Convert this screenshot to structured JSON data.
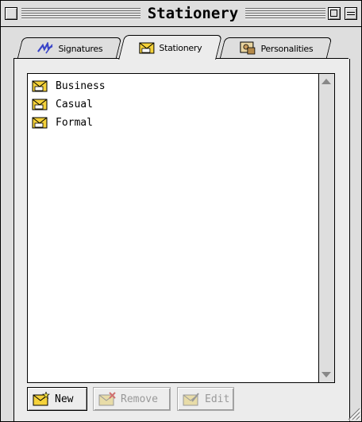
{
  "window": {
    "title": "Stationery"
  },
  "tabs": [
    {
      "label": "Signatures",
      "icon": "pen-icon",
      "active": false
    },
    {
      "label": "Stationery",
      "icon": "stationery-icon",
      "active": true
    },
    {
      "label": "Personalities",
      "icon": "personalities-icon",
      "active": false
    }
  ],
  "list": {
    "items": [
      {
        "label": "Business",
        "icon": "stationery-icon"
      },
      {
        "label": "Casual",
        "icon": "stationery-icon"
      },
      {
        "label": "Formal",
        "icon": "stationery-icon"
      }
    ]
  },
  "buttons": {
    "new_label": "New",
    "remove_label": "Remove",
    "edit_label": "Edit"
  },
  "colors": {
    "window_bg": "#dedede",
    "list_bg": "#ffffff",
    "icon_yellow": "#f5d23a",
    "disabled_text": "#999999"
  }
}
